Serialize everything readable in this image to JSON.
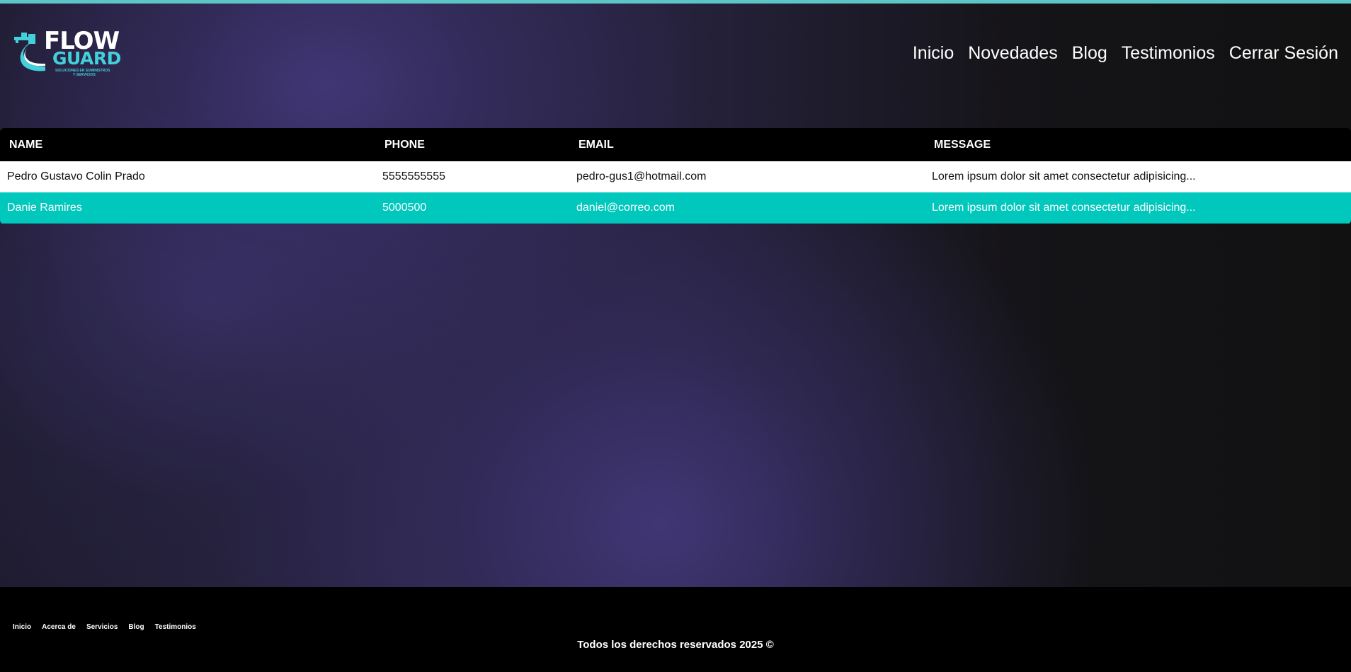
{
  "header": {
    "logo": {
      "title_top": "FLOW",
      "title_bottom": "GUARD",
      "tagline_line1": "SOLUCIONES EN SUMINISTROS",
      "tagline_line2": "Y SERVICIOS"
    },
    "nav": [
      {
        "label": "Inicio"
      },
      {
        "label": "Novedades"
      },
      {
        "label": "Blog"
      },
      {
        "label": "Testimonios"
      },
      {
        "label": "Cerrar Sesión"
      }
    ]
  },
  "table": {
    "columns": [
      "NAME",
      "PHONE",
      "EMAIL",
      "MESSAGE"
    ],
    "rows": [
      {
        "name": "Pedro Gustavo Colin Prado",
        "phone": "5555555555",
        "email": "pedro-gus1@hotmail.com",
        "message": "Lorem ipsum dolor sit amet consectetur adipisicing..."
      },
      {
        "name": "Danie Ramires",
        "phone": "5000500",
        "email": "daniel@correo.com",
        "message": "Lorem ipsum dolor sit amet consectetur adipisicing..."
      }
    ]
  },
  "footer": {
    "links": [
      {
        "label": "Inicio"
      },
      {
        "label": "Acerca de"
      },
      {
        "label": "Servicios"
      },
      {
        "label": "Blog"
      },
      {
        "label": "Testimonios"
      }
    ],
    "copyright": "Todos los derechos reservados 2025 ©"
  },
  "colors": {
    "accent": "#5cc6c6",
    "row_highlight": "#00c8bd",
    "logo_cyan": "#42d0da"
  },
  "icons": {
    "logo_mark": "faucet-water-drop-icon"
  }
}
